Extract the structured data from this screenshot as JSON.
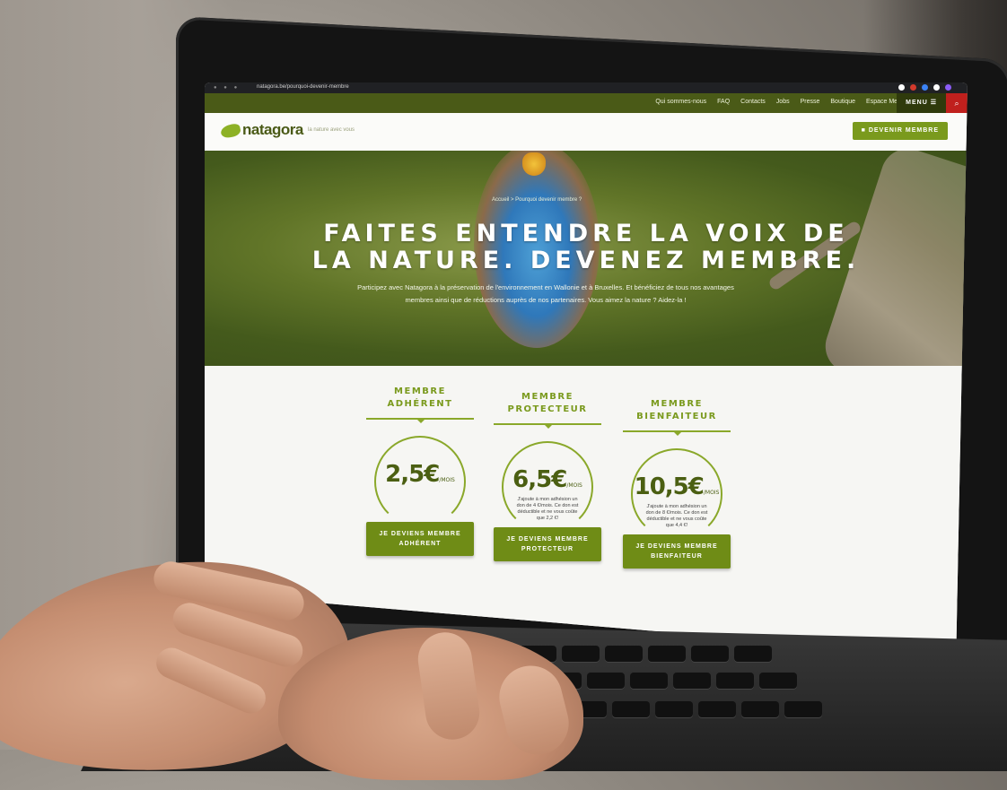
{
  "browser": {
    "url": "natagora.be/pourquoi-devenir-membre",
    "dots": "● ● ●"
  },
  "topnav": {
    "links": [
      "Qui sommes-nous",
      "FAQ",
      "Contacts",
      "Jobs",
      "Presse",
      "Boutique",
      "Espace Membre"
    ],
    "menu_label": "MENU ☰",
    "search_icon": "⌕"
  },
  "header": {
    "logo": "natagora",
    "tagline": "la nature avec vous",
    "cta": "■ DEVENIR MEMBRE"
  },
  "hero": {
    "breadcrumb": "Accueil  >  Pourquoi devenir membre ?",
    "title_line1": "FAITES ENTENDRE LA VOIX DE",
    "title_line2": "LA NATURE. DEVENEZ MEMBRE.",
    "text": "Participez avec Natagora à la préservation de l'environnement en Wallonie et à Bruxelles. Et bénéficiez de tous nos avantages membres ainsi que de réductions auprès de nos partenaires. Vous aimez la nature ? Aidez-la !"
  },
  "plans": [
    {
      "title_line1": "MEMBRE",
      "title_line2": "ADHÉRENT",
      "price": "2,5€",
      "period": "/MOIS",
      "note": "",
      "button": "JE DEVIENS MEMBRE ADHÉRENT"
    },
    {
      "title_line1": "MEMBRE",
      "title_line2": "PROTECTEUR",
      "price": "6,5€",
      "period": "/MOIS",
      "note": "J'ajoute à mon adhésion un don de 4 €/mois. Ce don est déductible et ne vous coûte que 2,2 €!",
      "button": "JE DEVIENS MEMBRE PROTECTEUR"
    },
    {
      "title_line1": "MEMBRE",
      "title_line2": "BIENFAITEUR",
      "price": "10,5€",
      "period": "/MOIS",
      "note": "J'ajoute à mon adhésion un don de 8 €/mois. Ce don est déductible et ne vous coûte que 4,4 €!",
      "button": "JE DEVIENS MEMBRE BIENFAITEUR"
    }
  ],
  "colors": {
    "brand_green": "#7a9a1d",
    "dark_green": "#4a5a17",
    "search_red": "#c0201d"
  }
}
